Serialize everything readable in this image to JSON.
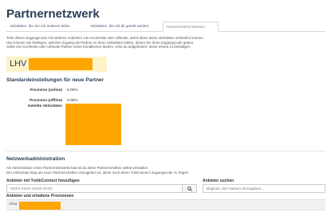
{
  "page": {
    "title": "Partnernetzwerk"
  },
  "tabs": [
    {
      "label": "Aktivitäten, die Sie mit anderen teilen"
    },
    {
      "label": "Aktivitäten, die mit dir geteilt werden"
    },
    {
      "label": "Netzwerkadministration"
    }
  ],
  "intro": {
    "line1": "Teile diesen Zugangscode mit anderen Anbietern von Accelerate oder Ultimate, damit diese deine Aktivitäten verkaufen können.",
    "line2": "Hier können Sie festlegen, welchen Zugang die Partner zu Ihren Aktivitäten haben, denen Sie Ihren Zugangscode geben.",
    "line3": "Sollte ein Accelerate-oder Ultimate Partner seine Konditionen ändern, wirst du aufgefordert, diese erneut zu bestätigen."
  },
  "access_code": {
    "prefix": "LHV"
  },
  "defaults": {
    "title": "Standardeinstellungen für neue Partner",
    "online_label": "Provision (online)",
    "online_value": "5.00%",
    "offline_label": "Provision (offline)",
    "offline_value": "0.00%",
    "shared_label": "Geteilte Aktivitäten"
  },
  "admin": {
    "title": "Netzwerkadministration",
    "desc1": "Als Administrator eines Partnernetzwerks kannst du deine Partnerschaften selbst verwalten.",
    "desc2": "Der einfachste Weg um neue Partnerschaften einzugehen ist, diese nach deren TrekConnect Zugangscode zu fragen",
    "add_label": "Anbieter mit TrekkConnect hinzufügen",
    "add_placeholder": "XXXX XXXX XXXX XXXX",
    "search_label": "Anbieter suchen",
    "search_placeholder": "Beginne, den Namen einzugeben...",
    "table_header": "Anbieter und erhaltene Provisionen",
    "row_prefix": "richa"
  },
  "colors": {
    "accent": "#2b3e55",
    "redaction": "#ffa500",
    "highlight": "#fdf3c9"
  }
}
